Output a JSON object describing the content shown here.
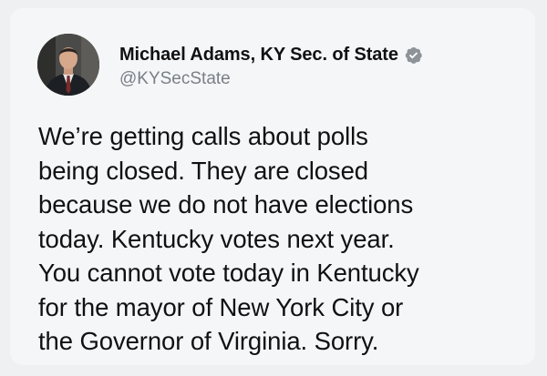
{
  "author": {
    "display_name": "Michael Adams, KY Sec. of State",
    "handle": "@KYSecState",
    "avatar_icon": "person-avatar",
    "verified_icon": "verified-badge-icon"
  },
  "tweet": {
    "lines": [
      "We’re getting calls about polls",
      "being closed. They are closed",
      "because we do not have elections",
      "today. Kentucky votes next year.",
      "You cannot vote today in Kentucky",
      "for the mayor of New York City or",
      "the Governor of Virginia. Sorry."
    ]
  },
  "colors": {
    "background": "#eef0f2",
    "card": "#f5f6f8",
    "text": "#111111",
    "handle": "#7a7f86",
    "verified_badge": "#8e9399"
  }
}
